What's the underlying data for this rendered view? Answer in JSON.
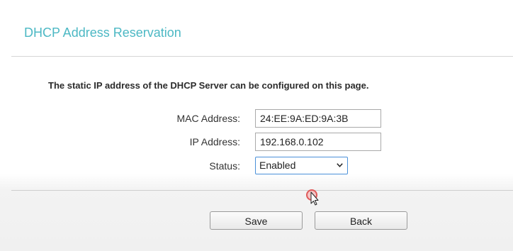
{
  "page": {
    "title": "DHCP Address Reservation",
    "description": "The static IP address of the DHCP Server can be configured on this page."
  },
  "form": {
    "mac_label": "MAC Address:",
    "mac_value": "24:EE:9A:ED:9A:3B",
    "ip_label": "IP Address:",
    "ip_value": "192.168.0.102",
    "status_label": "Status:",
    "status_value": "Enabled"
  },
  "buttons": {
    "save": "Save",
    "back": "Back"
  },
  "colors": {
    "title": "#4cb8c4",
    "select_border": "#4a90d9",
    "cursor_ring": "#e05a5a"
  },
  "icons": {
    "dropdown": "chevron-down-icon",
    "pointer": "mouse-pointer-icon"
  }
}
